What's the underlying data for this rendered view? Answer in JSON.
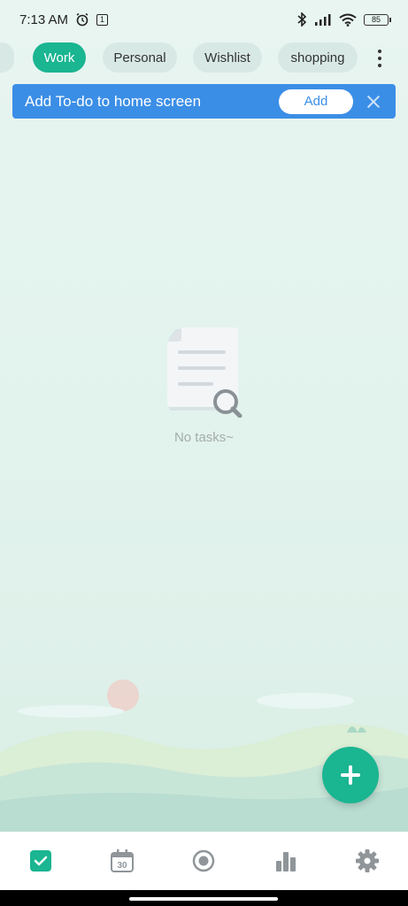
{
  "status_bar": {
    "time": "7:13 AM",
    "notification_badge": "1",
    "battery": "85"
  },
  "categories": {
    "items": [
      {
        "label": "Work",
        "active": true
      },
      {
        "label": "Personal",
        "active": false
      },
      {
        "label": "Wishlist",
        "active": false
      },
      {
        "label": "shopping",
        "active": false
      }
    ]
  },
  "banner": {
    "text": "Add To-do to home screen",
    "add_label": "Add"
  },
  "empty_state": {
    "text": "No tasks~"
  },
  "bottom_nav": {
    "calendar_day": "30",
    "items": [
      "tasks-icon",
      "calendar-icon",
      "focus-icon",
      "stats-icon",
      "settings-icon"
    ]
  },
  "colors": {
    "accent": "#1ab591",
    "banner": "#3b8ee6"
  }
}
